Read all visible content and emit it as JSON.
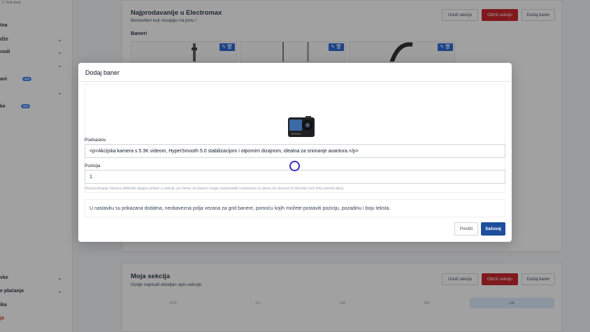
{
  "sidebar": {
    "shop_link": "Visit shop",
    "items": [
      {
        "label": "tna",
        "chevron": false,
        "badge": ""
      },
      {
        "label": "dže",
        "chevron": true,
        "badge": ""
      },
      {
        "label": "vodi",
        "chevron": true,
        "badge": ""
      },
      {
        "label": "",
        "chevron": true,
        "badge": ""
      },
      {
        "label": "ani",
        "chevron": false,
        "badge": "NEW"
      },
      {
        "label": "",
        "chevron": true,
        "badge": ""
      },
      {
        "label": "ke",
        "chevron": false,
        "badge": "NEW"
      },
      {
        "label": "vke",
        "chevron": true,
        "badge": ""
      },
      {
        "label": "e plaćanja",
        "chevron": true,
        "badge": ""
      },
      {
        "label": "ika",
        "chevron": false,
        "badge": ""
      },
      {
        "label": "ja",
        "chevron": false,
        "badge": ""
      }
    ]
  },
  "section1": {
    "title": "Najprodavanije u Electromax",
    "subtitle": "Bestselleri koji osvajaju na prvu !",
    "edit_label": "Uredi sekciju",
    "delete_label": "Obriši sekciju",
    "add_label": "Dodaj baner",
    "banners_label": "Baneri"
  },
  "section2": {
    "title": "Moja sekcija",
    "subtitle": "Ovdje napisati detaljan opis sekcije",
    "edit_label": "Uredi sekciju",
    "delete_label": "Obriši sekciju",
    "add_label": "Dodaj baner",
    "sizes": [
      "XXS",
      "XS",
      "SM",
      "MD",
      "LG"
    ],
    "active_size": "LG"
  },
  "modal": {
    "title": "Dodaj baner",
    "subtitle_label": "Podnaslov",
    "subtitle_value": "<p>Akcijska kamera s 5.3K videom, HyperSmooth 5.0 stabilizacijom i otpornim dizajnom, idealna za snimanje avantura.</p>",
    "position_label": "Pozicija",
    "position_value": "1",
    "hint": "Pozicioniranje banera definiše njegov prikaz u sekciji, pri čemu se baneri mogu rasporediti vodoravno (s lijeva na desno) ili okomito (od vrha prema dnu).",
    "info": "U nastavku su prikazana dodatna, neobavezna polja vezana za grid banere, pomoću kojih možete postaviti poziciju, pozadinu i boju teksta.",
    "cancel_label": "Poništi",
    "save_label": "Sačuvaj"
  },
  "colors": {
    "primary": "#1d4f9c",
    "danger": "#c6161e",
    "badge": "#3b82f6",
    "cursor": "#3730c4"
  }
}
